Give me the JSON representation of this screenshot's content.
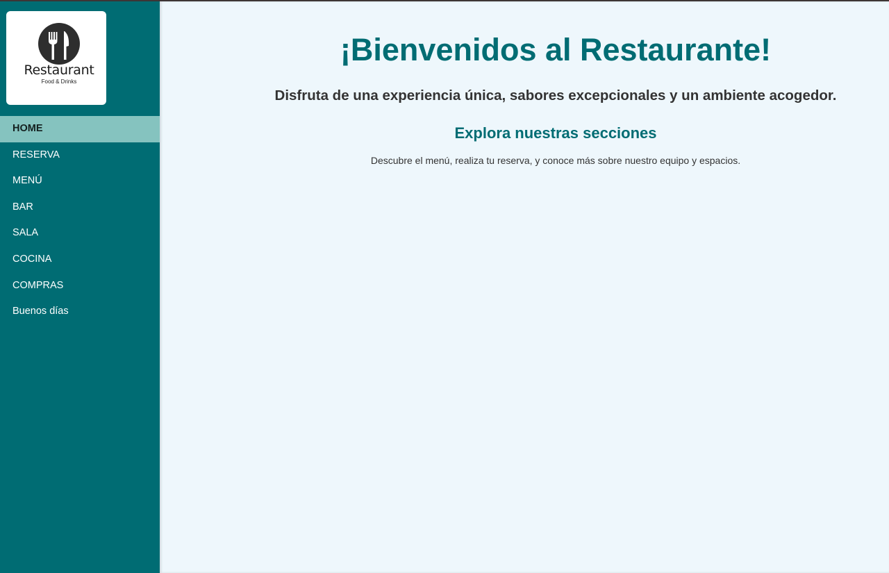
{
  "sidebar": {
    "logo": {
      "icon": "fork-knife-icon",
      "name": "Restaurant",
      "tagline": "Food & Drinks"
    },
    "items": [
      {
        "label": "HOME",
        "active": true
      },
      {
        "label": "RESERVA",
        "active": false
      },
      {
        "label": "MENÚ",
        "active": false
      },
      {
        "label": "BAR",
        "active": false
      },
      {
        "label": "SALA",
        "active": false
      },
      {
        "label": "COCINA",
        "active": false
      },
      {
        "label": "COMPRAS",
        "active": false
      },
      {
        "label": "Buenos días",
        "active": false
      }
    ]
  },
  "main": {
    "title": "¡Bienvenidos al Restaurante!",
    "subtitle": "Disfruta de una experiencia única, sabores excepcionales y un ambiente acogedor.",
    "sections_heading": "Explora nuestras secciones",
    "sections_text": "Descubre el menú, realiza tu reserva, y conoce más sobre nuestro equipo y espacios."
  },
  "colors": {
    "sidebar_bg": "#006c73",
    "active_item_bg": "#85c3bf",
    "main_bg": "#eef7fc",
    "accent": "#006c73",
    "text": "#333333"
  }
}
